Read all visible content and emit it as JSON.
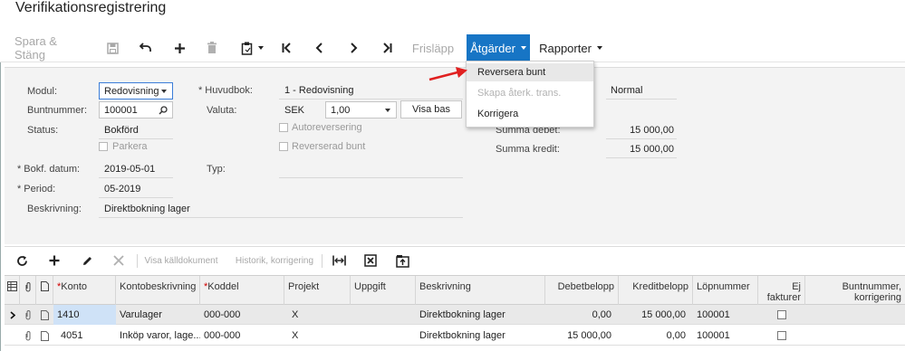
{
  "page_title": "Verifikationsregistrering",
  "toolbar": {
    "save_close": "Spara & Stäng",
    "release": "Frisläpp",
    "actions": "Åtgärder",
    "reports": "Rapporter",
    "icons": [
      "save-icon",
      "undo-icon",
      "add-icon",
      "delete-icon",
      "clipboard-icon",
      "first-icon",
      "prev-icon",
      "next-icon",
      "last-icon"
    ]
  },
  "form": {
    "module_label": "Modul:",
    "module_value": "Redovisning",
    "batch_label": "Buntnummer:",
    "batch_value": "100001",
    "status_label": "Status:",
    "status_value": "Bokförd",
    "park_label": "Parkera",
    "post_date_label": "Bokf. datum:",
    "post_date_value": "2019-05-01",
    "period_label": "Period:",
    "period_value": "05-2019",
    "desc_label": "Beskrivning:",
    "desc_value": "Direktbokning lager",
    "ledger_label": "Huvudbok:",
    "ledger_value": "1 - Redovisning",
    "currency_label": "Valuta:",
    "currency_value": "SEK",
    "rate_value": "1,00",
    "view_base": "Visa bas",
    "auto_reverse": "Autoreversering",
    "reversed_batch": "Reverserad bunt",
    "type_label": "Typ:",
    "type_value": "Normal",
    "debit_total_label": "Summa debet:",
    "debit_total_value": "15 000,00",
    "credit_total_label": "Summa kredit:",
    "credit_total_value": "15 000,00"
  },
  "actions_menu": {
    "items": [
      {
        "label": "Reversera bunt",
        "enabled": true
      },
      {
        "label": "Skapa återk. trans.",
        "enabled": false
      },
      {
        "label": "Korrigera",
        "enabled": true
      }
    ]
  },
  "grid_toolbar": {
    "view_source": "Visa källdokument",
    "history_correction": "Historik, korrigering"
  },
  "grid": {
    "columns": [
      "Konto",
      "Kontobeskrivning",
      "Koddel",
      "Projekt",
      "Uppgift",
      "Beskrivning",
      "Debetbelopp",
      "Kreditbelopp",
      "Löpnummer",
      "Ej fakturer",
      "Buntnummer, korrigering"
    ],
    "rows": [
      {
        "account": "1410",
        "account_desc": "Varulager",
        "subaccount": "000-000",
        "project": "X",
        "task": "",
        "description": "Direktbokning lager",
        "debit": "0,00",
        "credit": "15 000,00",
        "ref": "100001"
      },
      {
        "account": "4051",
        "account_desc": "Inköp varor, lage...",
        "subaccount": "000-000",
        "project": "X",
        "task": "",
        "description": "Direktbokning lager",
        "debit": "15 000,00",
        "credit": "0,00",
        "ref": "100001"
      }
    ]
  },
  "colors": {
    "accent": "#1775c5",
    "arrow": "#e02020"
  }
}
